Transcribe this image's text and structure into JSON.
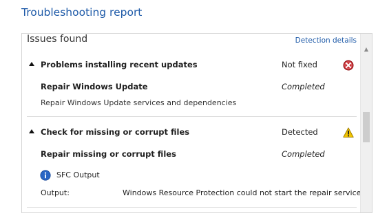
{
  "page": {
    "title": "Troubleshooting report"
  },
  "panel": {
    "header": "Issues found",
    "detection_link": "Detection details"
  },
  "issues": [
    {
      "title": "Problems installing recent updates",
      "status": "Not fixed",
      "status_icon": "error-icon",
      "fix": {
        "title": "Repair Windows Update",
        "status": "Completed",
        "description": "Repair Windows Update services and dependencies"
      }
    },
    {
      "title": "Check for missing or corrupt files",
      "status": "Detected",
      "status_icon": "warning-icon",
      "fix": {
        "title": "Repair missing or corrupt files",
        "status": "Completed",
        "details_label": "SFC Output",
        "output_label": "Output:",
        "output_value": "Windows Resource Protection could not start the repair service."
      }
    }
  ],
  "colors": {
    "link": "#1e5aa8",
    "error": "#c8282e",
    "warning": "#f2c400",
    "info": "#2a66c4"
  }
}
